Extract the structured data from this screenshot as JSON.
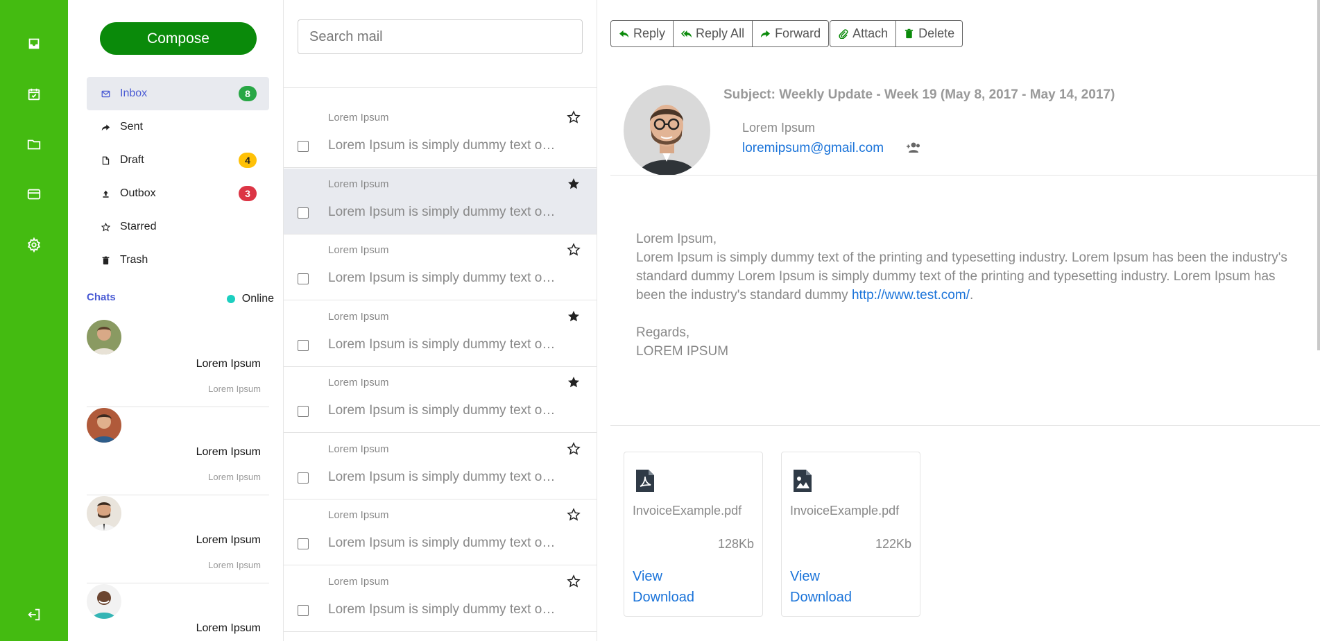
{
  "compose_label": "Compose",
  "folders": [
    {
      "label": "Inbox",
      "badge": "8",
      "badge_color": "green",
      "icon": "mail-icon"
    },
    {
      "label": "Sent",
      "badge": "",
      "icon": "share-arrow-icon"
    },
    {
      "label": "Draft",
      "badge": "4",
      "badge_color": "yellow",
      "icon": "file-icon"
    },
    {
      "label": "Outbox",
      "badge": "3",
      "badge_color": "red",
      "icon": "upload-icon"
    },
    {
      "label": "Starred",
      "badge": "",
      "icon": "star-icon"
    },
    {
      "label": "Trash",
      "badge": "",
      "icon": "trash-icon"
    }
  ],
  "chats": {
    "title": "Chats",
    "status": "Online",
    "items": [
      {
        "name": "Lorem Ipsum",
        "message": "Lorem Ipsum"
      },
      {
        "name": "Lorem Ipsum",
        "message": "Lorem Ipsum"
      },
      {
        "name": "Lorem Ipsum",
        "message": "Lorem Ipsum"
      },
      {
        "name": "Lorem Ipsum",
        "message": ""
      }
    ]
  },
  "search": {
    "placeholder": "Search mail"
  },
  "mails": [
    {
      "sender": "Lorem Ipsum",
      "preview": "Lorem Ipsum is simply dummy text of the printing",
      "starred": false,
      "selected": false
    },
    {
      "sender": "Lorem Ipsum",
      "preview": "Lorem Ipsum is simply dummy text of the printing",
      "starred": true,
      "selected": true
    },
    {
      "sender": "Lorem Ipsum",
      "preview": "Lorem Ipsum is simply dummy text of the printing",
      "starred": false,
      "selected": false
    },
    {
      "sender": "Lorem Ipsum",
      "preview": "Lorem Ipsum is simply dummy text of the printing",
      "starred": true,
      "selected": false
    },
    {
      "sender": "Lorem Ipsum",
      "preview": "Lorem Ipsum is simply dummy text of the printing",
      "starred": true,
      "selected": false
    },
    {
      "sender": "Lorem Ipsum",
      "preview": "Lorem Ipsum is simply dummy text of the printing",
      "starred": false,
      "selected": false
    },
    {
      "sender": "Lorem Ipsum",
      "preview": "Lorem Ipsum is simply dummy text of the printing",
      "starred": false,
      "selected": false
    },
    {
      "sender": "Lorem Ipsum",
      "preview": "Lorem Ipsum is simply dummy text of the printing",
      "starred": false,
      "selected": false
    }
  ],
  "toolbar": {
    "reply": "Reply",
    "reply_all": "Reply All",
    "forward": "Forward",
    "attach": "Attach",
    "delete": "Delete"
  },
  "message": {
    "subject": "Subject: Weekly Update - Week 19 (May 8, 2017 - May 14, 2017)",
    "from_name": "Lorem Ipsum",
    "from_email": "loremipsum@gmail.com",
    "greeting": "Lorem Ipsum,",
    "body": "Lorem Ipsum is simply dummy text of the printing and typesetting industry. Lorem Ipsum has been the industry's standard dummy Lorem Ipsum is simply dummy text of the printing and typesetting industry. Lorem Ipsum has been the industry's standard dummy ",
    "link": "http://www.test.com/",
    "link_suffix": ".",
    "signoff": "Regards,",
    "signature": "LOREM IPSUM"
  },
  "attachments": [
    {
      "name": "InvoiceExample.pdf",
      "size": "128Kb",
      "view": "View",
      "download": "Download",
      "icon": "pdf-file-icon"
    },
    {
      "name": "InvoiceExample.pdf",
      "size": "122Kb",
      "view": "View",
      "download": "Download",
      "icon": "image-file-icon"
    }
  ],
  "colors": {
    "rail": "#44bb11",
    "compose": "#0a8a0a",
    "accent": "#4a5bd4",
    "link": "#1a73d9"
  }
}
